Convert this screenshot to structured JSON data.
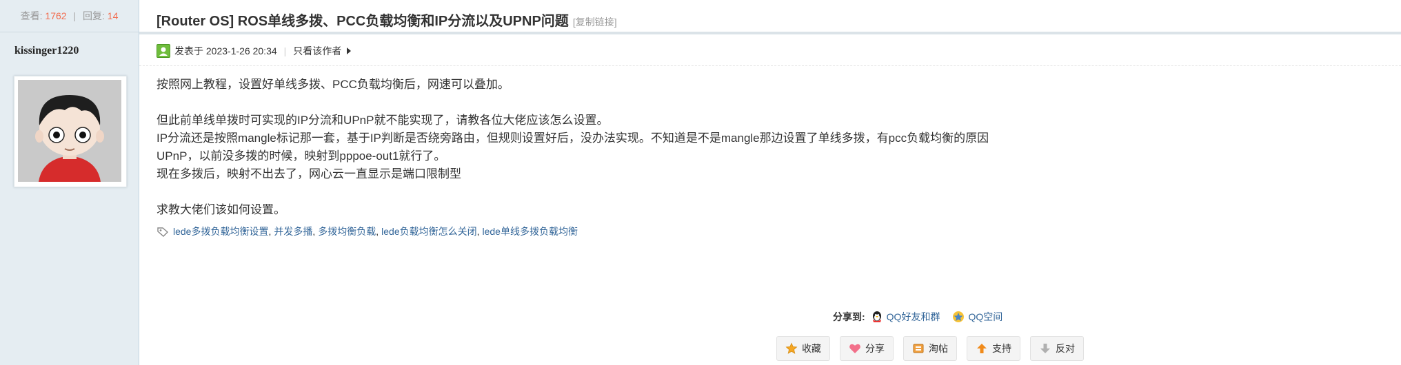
{
  "sidebar": {
    "views_label": "查看:",
    "views": "1762",
    "replies_label": "回复:",
    "replies": "14",
    "author": "kissinger1220"
  },
  "post": {
    "title": "[Router OS] ROS单线多拨、PCC负载均衡和IP分流以及UPNP问题",
    "copy_link": "[复制链接]",
    "posted_prefix": "发表于",
    "posted_time": "2023-1-26 20:34",
    "only_author": "只看该作者",
    "body": [
      "按照网上教程，设置好单线多拨、PCC负载均衡后，网速可以叠加。",
      "",
      "但此前单线单拨时可实现的IP分流和UPnP就不能实现了，请教各位大佬应该怎么设置。",
      "IP分流还是按照mangle标记那一套，基于IP判断是否绕旁路由，但规则设置好后，没办法实现。不知道是不是mangle那边设置了单线多拨，有pcc负载均衡的原因",
      "UPnP，以前没多拨的时候，映射到pppoe-out1就行了。",
      "现在多拨后，映射不出去了，网心云一直显示是端口限制型",
      "",
      "求教大佬们该如何设置。"
    ],
    "tags": [
      "lede多拨负载均衡设置",
      "并发多播",
      "多拨均衡负载",
      "lede负载均衡怎么关闭",
      "lede单线多拨负载均衡"
    ],
    "tag_separator": ","
  },
  "share": {
    "label": "分享到:",
    "qq_friends": "QQ好友和群",
    "qzone": "QQ空间"
  },
  "actions": {
    "favorite": "收藏",
    "share": "分享",
    "taotie": "淘帖",
    "support": "支持",
    "oppose": "反对"
  },
  "icons": {
    "online": "user-online-icon",
    "tag": "tag-icon",
    "qq": "qq-penguin-icon",
    "qzone": "qzone-star-icon",
    "favorite": "star-icon",
    "share": "heart-icon",
    "taotie": "box-icon",
    "support": "arrow-up-icon",
    "oppose": "arrow-down-icon"
  },
  "colors": {
    "sidebar_bg": "#e5edf2",
    "link": "#336699",
    "stat_number": "#f26c4f"
  }
}
